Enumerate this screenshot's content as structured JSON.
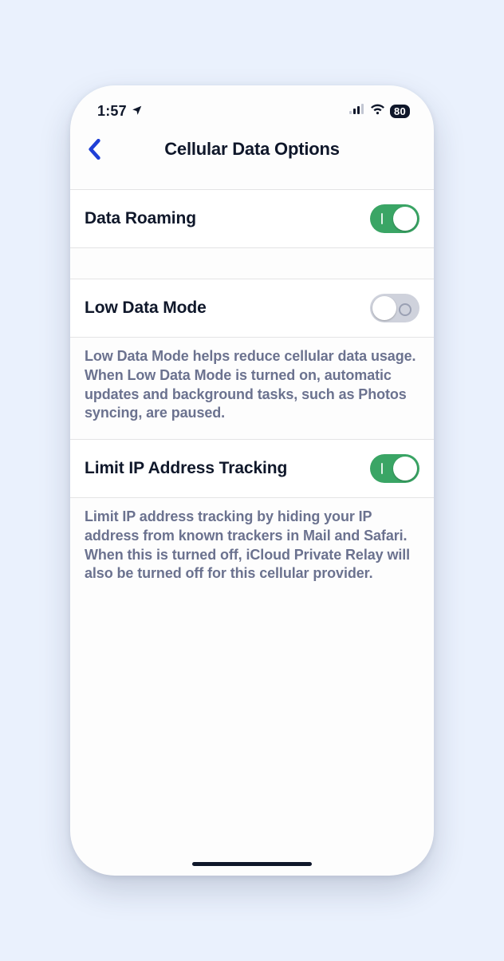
{
  "status_bar": {
    "time": "1:57",
    "battery_percent": "80"
  },
  "header": {
    "title": "Cellular Data Options"
  },
  "sections": {
    "data_roaming": {
      "label": "Data Roaming",
      "enabled": true
    },
    "low_data_mode": {
      "label": "Low Data Mode",
      "enabled": false,
      "footer": "Low Data Mode helps reduce cellular data usage. When Low Data Mode is turned on, automatic updates and background tasks, such as Photos syncing, are paused."
    },
    "limit_ip_tracking": {
      "label": "Limit IP Address Tracking",
      "enabled": true,
      "footer": "Limit IP address tracking by hiding your IP address from known trackers in Mail and Safari. When this is turned off, iCloud Private Relay will also be turned off for this cellular provider."
    }
  }
}
